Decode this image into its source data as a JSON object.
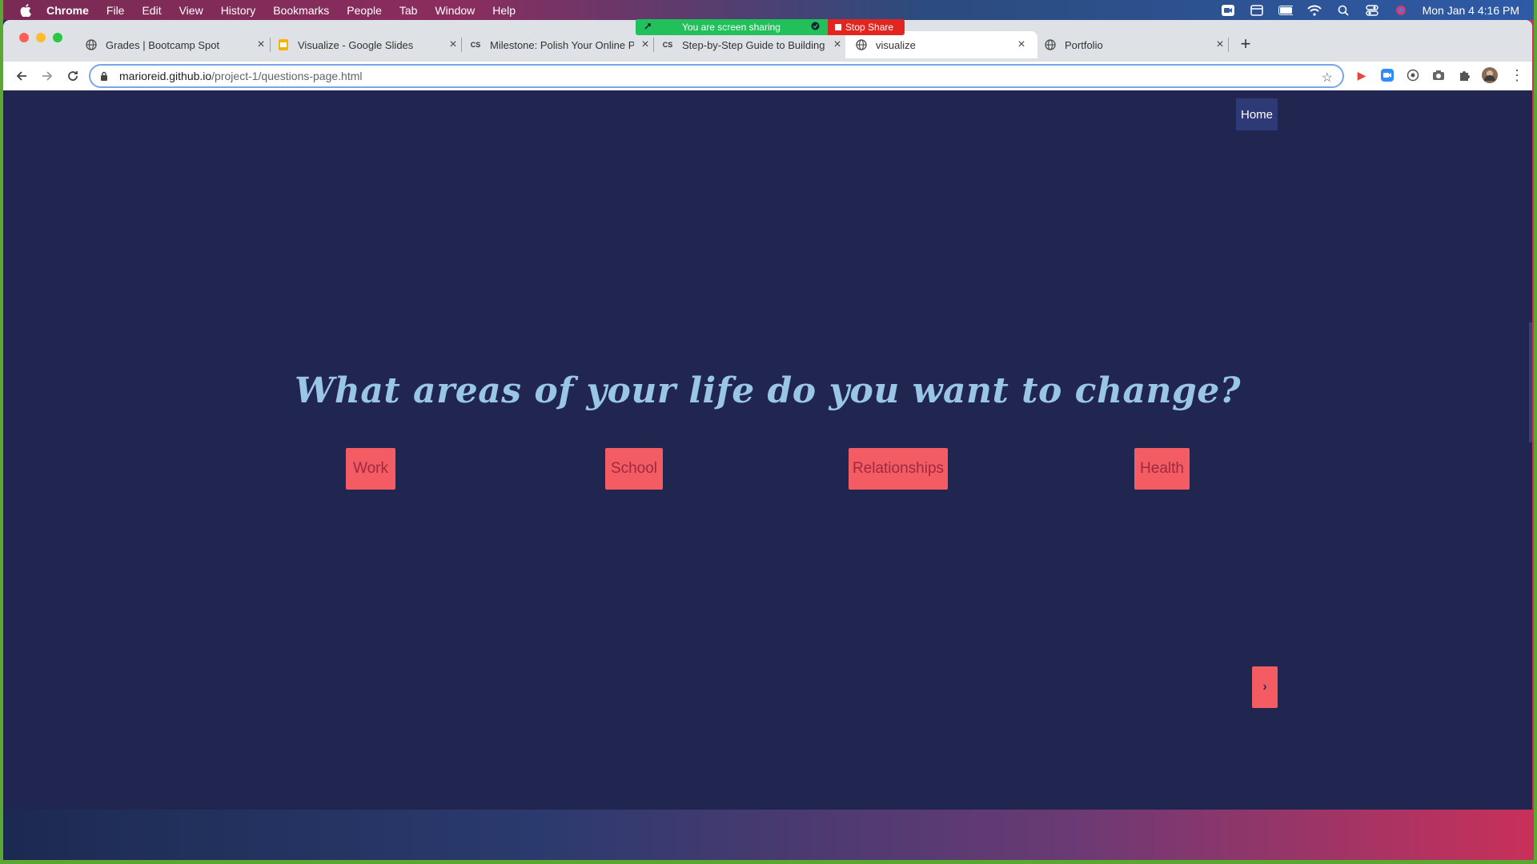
{
  "menubar": {
    "app": "Chrome",
    "items": [
      "File",
      "Edit",
      "View",
      "History",
      "Bookmarks",
      "People",
      "Tab",
      "Window",
      "Help"
    ],
    "clock": "Mon Jan 4  4:16 PM"
  },
  "share_banner": {
    "status": "You are screen sharing",
    "stop_label": "Stop Share"
  },
  "tabs": [
    {
      "title": "Grades | Bootcamp Spot",
      "favicon": "globe-icon"
    },
    {
      "title": "Visualize - Google Slides",
      "favicon": "slides-icon"
    },
    {
      "title": "Milestone: Polish Your Online P",
      "favicon": "cs-icon"
    },
    {
      "title": "Step-by-Step Guide to Building",
      "favicon": "cs-icon"
    },
    {
      "title": "visualize",
      "favicon": "globe-icon",
      "active": true
    },
    {
      "title": "Portfolio",
      "favicon": "globe-icon"
    }
  ],
  "favicon_text": {
    "cs": "CS"
  },
  "address_bar": {
    "host": "marioreid.github.io",
    "path": "/project-1/questions-page.html"
  },
  "page": {
    "home_link": "Home",
    "question": "What areas of your life do you want to change?",
    "choices": [
      "Work",
      "School",
      "Relationships",
      "Health"
    ],
    "next_icon": "›"
  },
  "colors": {
    "page_background": "#212650",
    "button": "#f25c62",
    "heading": "#9ac6e6",
    "home_link_bg": "#2e3978"
  }
}
